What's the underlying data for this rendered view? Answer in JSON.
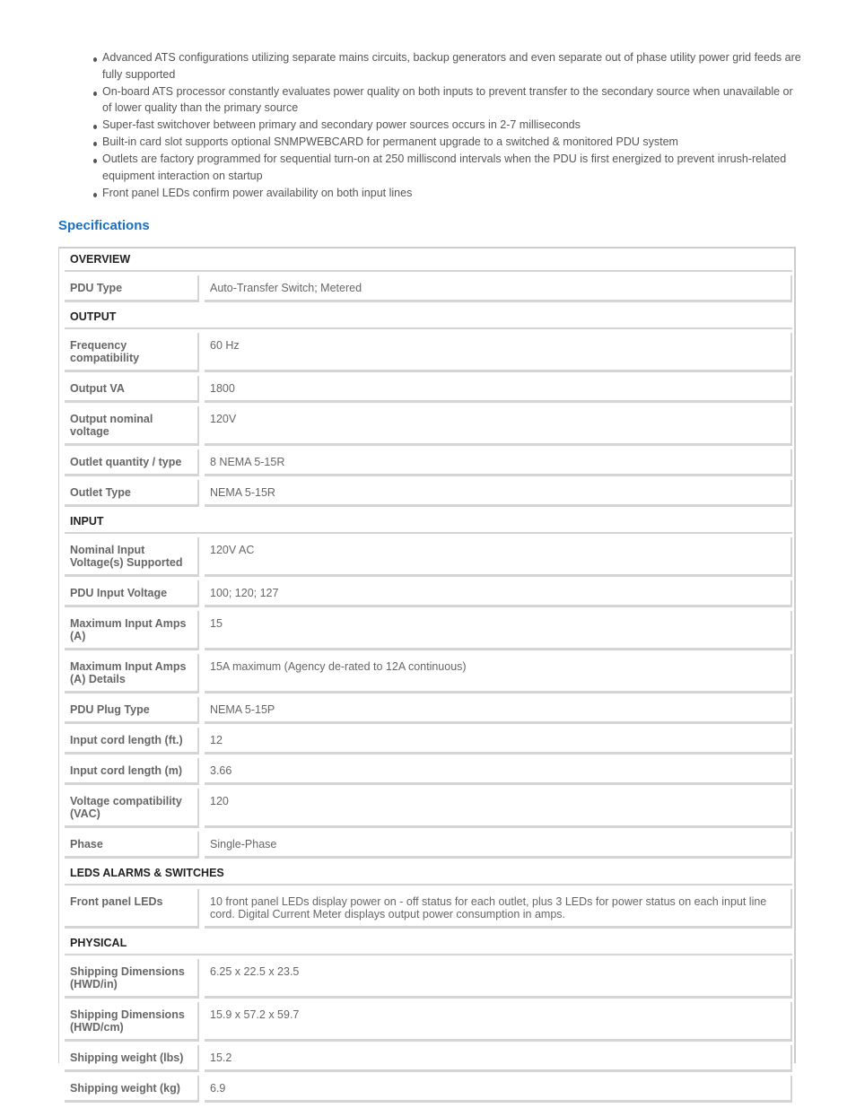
{
  "features": [
    "Advanced ATS configurations utilizing separate mains circuits, backup generators and even separate out of phase utility power grid feeds are fully supported",
    "On-board ATS processor constantly evaluates power quality on both inputs to prevent transfer to the secondary source when unavailable or of lower quality than the primary source",
    "Super-fast switchover between primary and secondary power sources occurs in 2-7 milliseconds",
    "Built-in card slot supports optional SNMPWEBCARD for permanent upgrade to a switched & monitored PDU system",
    "Outlets are factory programmed for sequential turn-on at 250 milliscond intervals when the PDU is first energized to prevent inrush-related equipment interaction on startup",
    "Front panel LEDs confirm power availability on both input lines"
  ],
  "specifications": {
    "title": "Specifications",
    "groups": [
      {
        "name": "OVERVIEW",
        "rows": [
          {
            "label": "PDU Type",
            "value": "Auto-Transfer Switch; Metered"
          }
        ]
      },
      {
        "name": "OUTPUT",
        "rows": [
          {
            "label": "Frequency compatibility",
            "value": "60 Hz"
          },
          {
            "label": "Output VA",
            "value": "1800"
          },
          {
            "label": "Output nominal voltage",
            "value": "120V"
          },
          {
            "label": "Outlet quantity / type",
            "value": "8 NEMA 5-15R"
          },
          {
            "label": "Outlet Type",
            "value": "NEMA 5-15R"
          }
        ]
      },
      {
        "name": "INPUT",
        "rows": [
          {
            "label": "Nominal Input Voltage(s) Supported",
            "value": "120V AC"
          },
          {
            "label": "PDU Input Voltage",
            "value": "100; 120; 127"
          },
          {
            "label": "Maximum Input Amps (A)",
            "value": "15"
          },
          {
            "label": "Maximum Input Amps (A) Details",
            "value": "15A maximum (Agency de-rated to 12A continuous)"
          },
          {
            "label": "PDU Plug Type",
            "value": "NEMA 5-15P"
          },
          {
            "label": "Input cord length (ft.)",
            "value": "12"
          },
          {
            "label": "Input cord length (m)",
            "value": "3.66"
          },
          {
            "label": "Voltage compatibility (VAC)",
            "value": "120"
          },
          {
            "label": "Phase",
            "value": "Single-Phase"
          }
        ]
      },
      {
        "name": "LEDS ALARMS & SWITCHES",
        "rows": [
          {
            "label": "Front panel LEDs",
            "value": "10 front panel LEDs display power on - off status for each outlet, plus 3 LEDs for power status on each input line cord. Digital Current Meter displays output power consumption in amps."
          }
        ]
      },
      {
        "name": "PHYSICAL",
        "rows": [
          {
            "label": "Shipping Dimensions (HWD/in)",
            "value": "6.25 x 22.5 x 23.5"
          },
          {
            "label": "Shipping Dimensions (HWD/cm)",
            "value": "15.9 x 57.2 x 59.7"
          },
          {
            "label": "Shipping weight (lbs)",
            "value": "15.2"
          },
          {
            "label": "Shipping weight (kg)",
            "value": "6.9"
          }
        ]
      }
    ]
  }
}
